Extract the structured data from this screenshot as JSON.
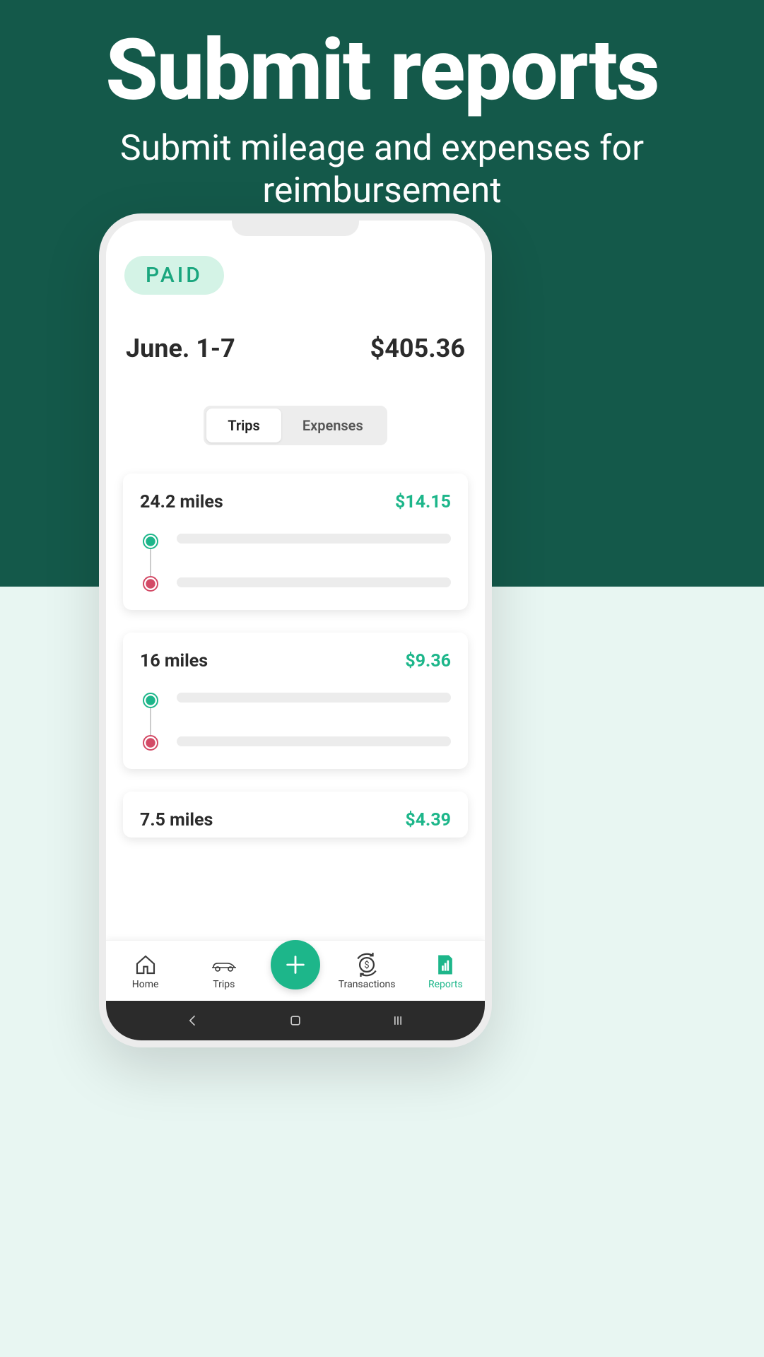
{
  "promo": {
    "title": "Submit reports",
    "subtitle": "Submit mileage and expenses for reimbursement"
  },
  "report": {
    "status_badge": "PAID",
    "date_range": "June. 1-7",
    "total": "$405.36"
  },
  "segments": {
    "trips": "Trips",
    "expenses": "Expenses"
  },
  "trips": [
    {
      "miles": "24.2 miles",
      "amount": "$14.15"
    },
    {
      "miles": "16 miles",
      "amount": "$9.36"
    },
    {
      "miles": "7.5 miles",
      "amount": "$4.39"
    }
  ],
  "nav": {
    "home": "Home",
    "trips": "Trips",
    "transactions": "Transactions",
    "reports": "Reports"
  }
}
